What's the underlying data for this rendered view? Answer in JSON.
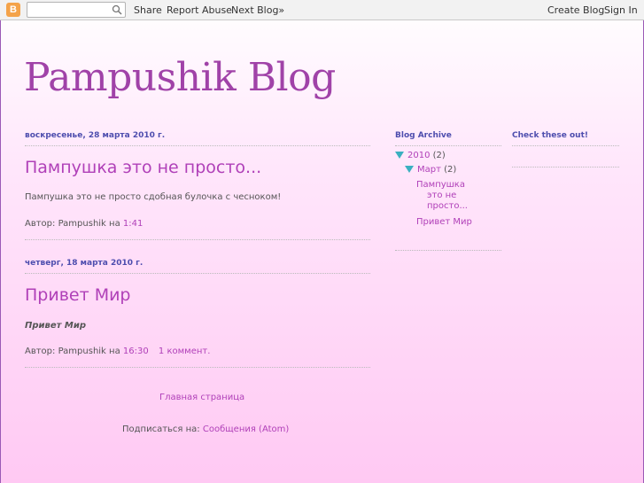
{
  "navbar": {
    "share": "Share",
    "report_abuse": "Report Abuse",
    "next_blog": "Next Blog»",
    "create_blog": "Create Blog",
    "sign_in": "Sign In"
  },
  "blog": {
    "title": "Pampushik Blog"
  },
  "posts": [
    {
      "date": "воскресенье, 28 марта 2010 г.",
      "title": "Пампушка это не просто...",
      "body": "Пампушка это не просто сдобная булочка с чесноком!",
      "author_prefix": "Автор:",
      "author": "Pampushik",
      "at": "на",
      "time": "1:41",
      "comments": ""
    },
    {
      "date": "четверг, 18 марта 2010 г.",
      "title": "Привет Мир",
      "body": "Привет Мир",
      "author_prefix": "Автор:",
      "author": "Pampushik",
      "at": "на",
      "time": "16:30",
      "comments": "1 коммент."
    }
  ],
  "footer": {
    "home": "Главная страница",
    "subscribe_prefix": "Подписаться на:",
    "subscribe_link": "Сообщения (Atom)"
  },
  "sidebar": {
    "archive_title": "Blog Archive",
    "year": "2010",
    "year_count": "(2)",
    "month": "Март",
    "month_count": "(2)",
    "archive_posts": [
      "Пампушка",
      "это не",
      "просто...",
      "Привет Мир"
    ],
    "links_title": "Check these out!"
  },
  "colors": {
    "accent": "#b040b8",
    "header": "#4d4dae",
    "title": "#a042a8"
  }
}
